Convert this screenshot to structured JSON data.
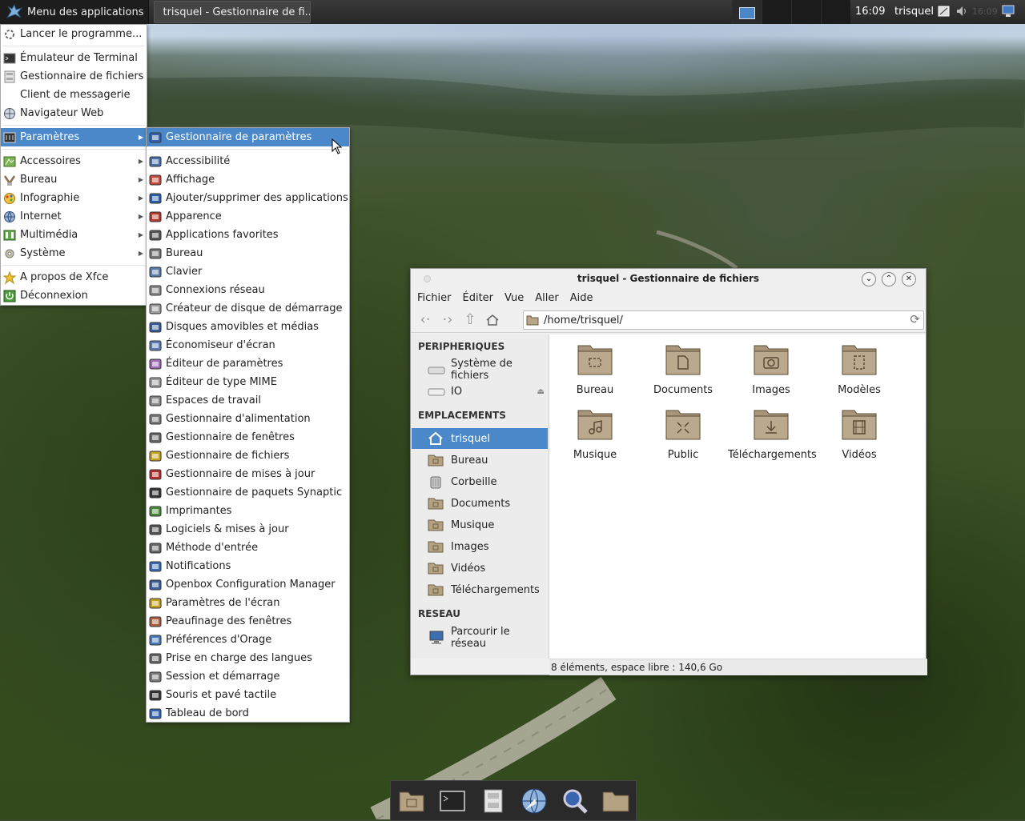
{
  "top_panel": {
    "apps_menu_label": "Menu des applications",
    "task_label": "trisquel - Gestionnaire de fi...",
    "clock": "16:09",
    "user": "trisquel",
    "tray_faded_time": "16:09"
  },
  "app_menu": {
    "items": [
      {
        "label": "Lancer le programme...",
        "icon": "run-icon"
      },
      {
        "label": "Émulateur de Terminal",
        "icon": "terminal-icon"
      },
      {
        "label": "Gestionnaire de fichiers",
        "icon": "file-manager-icon"
      },
      {
        "label": "Client de messagerie",
        "icon": "mail-icon"
      },
      {
        "label": "Navigateur Web",
        "icon": "web-browser-icon"
      },
      {
        "label": "Paramètres",
        "icon": "settings-icon",
        "submenu": true,
        "selected": true
      },
      {
        "label": "Accessoires",
        "icon": "accessories-icon",
        "submenu": true
      },
      {
        "label": "Bureau",
        "icon": "office-icon",
        "submenu": true
      },
      {
        "label": "Infographie",
        "icon": "graphics-icon",
        "submenu": true
      },
      {
        "label": "Internet",
        "icon": "internet-icon",
        "submenu": true
      },
      {
        "label": "Multimédia",
        "icon": "multimedia-icon",
        "submenu": true
      },
      {
        "label": "Système",
        "icon": "system-icon",
        "submenu": true
      },
      {
        "label": "A propos de Xfce",
        "icon": "about-icon"
      },
      {
        "label": "Déconnexion",
        "icon": "logout-icon"
      }
    ]
  },
  "settings_menu": {
    "items": [
      {
        "label": "Gestionnaire de paramètres",
        "selected": true
      },
      {
        "label": "Accessibilité"
      },
      {
        "label": "Affichage"
      },
      {
        "label": "Ajouter/supprimer des applications"
      },
      {
        "label": "Apparence"
      },
      {
        "label": "Applications favorites"
      },
      {
        "label": "Bureau"
      },
      {
        "label": "Clavier"
      },
      {
        "label": "Connexions réseau"
      },
      {
        "label": "Créateur de disque de démarrage"
      },
      {
        "label": "Disques amovibles et médias"
      },
      {
        "label": "Économiseur d'écran"
      },
      {
        "label": "Éditeur de paramètres"
      },
      {
        "label": "Éditeur de type MIME"
      },
      {
        "label": "Espaces de travail"
      },
      {
        "label": "Gestionnaire d'alimentation"
      },
      {
        "label": "Gestionnaire de fenêtres"
      },
      {
        "label": "Gestionnaire de fichiers"
      },
      {
        "label": "Gestionnaire de mises à jour"
      },
      {
        "label": "Gestionnaire de paquets Synaptic"
      },
      {
        "label": "Imprimantes"
      },
      {
        "label": "Logiciels & mises à jour"
      },
      {
        "label": "Méthode d'entrée"
      },
      {
        "label": "Notifications"
      },
      {
        "label": "Openbox Configuration Manager"
      },
      {
        "label": "Paramètres de l'écran"
      },
      {
        "label": "Peaufinage des fenêtres"
      },
      {
        "label": "Préférences d'Orage"
      },
      {
        "label": "Prise en charge des langues"
      },
      {
        "label": "Session et démarrage"
      },
      {
        "label": "Souris et pavé tactile"
      },
      {
        "label": "Tableau de bord"
      }
    ]
  },
  "file_manager": {
    "title": "trisquel - Gestionnaire de fichiers",
    "menubar": [
      "Fichier",
      "Éditer",
      "Vue",
      "Aller",
      "Aide"
    ],
    "location": "/home/trisquel/",
    "sidebar": {
      "devices_header": "PERIPHERIQUES",
      "devices": [
        {
          "label": "Système de fichiers",
          "icon": "drive-icon"
        },
        {
          "label": "IO",
          "icon": "drive-icon",
          "eject": true
        }
      ],
      "places_header": "EMPLACEMENTS",
      "places": [
        {
          "label": "trisquel",
          "icon": "home-icon",
          "selected": true
        },
        {
          "label": "Bureau",
          "icon": "folder-icon"
        },
        {
          "label": "Corbeille",
          "icon": "trash-icon"
        },
        {
          "label": "Documents",
          "icon": "folder-icon"
        },
        {
          "label": "Musique",
          "icon": "folder-icon"
        },
        {
          "label": "Images",
          "icon": "folder-icon"
        },
        {
          "label": "Vidéos",
          "icon": "folder-icon"
        },
        {
          "label": "Téléchargements",
          "icon": "folder-icon"
        }
      ],
      "network_header": "RESEAU",
      "network": [
        {
          "label": "Parcourir le réseau",
          "icon": "network-icon"
        }
      ]
    },
    "files": [
      {
        "label": "Bureau",
        "emblem": "desktop"
      },
      {
        "label": "Documents",
        "emblem": "document"
      },
      {
        "label": "Images",
        "emblem": "camera"
      },
      {
        "label": "Modèles",
        "emblem": "template"
      },
      {
        "label": "Musique",
        "emblem": "music"
      },
      {
        "label": "Public",
        "emblem": "share"
      },
      {
        "label": "Téléchargements",
        "emblem": "download"
      },
      {
        "label": "Vidéos",
        "emblem": "film"
      }
    ],
    "status": "8 éléments, espace libre : 140,6 Go"
  },
  "dock": {
    "items": [
      "home-folder-icon",
      "terminal-icon",
      "file-cabinet-icon",
      "web-browser-icon",
      "search-icon",
      "folder-icon"
    ]
  },
  "colors": {
    "selection": "#4a88c9",
    "folder": "#a8957a",
    "panel": "#2c2c2c"
  }
}
